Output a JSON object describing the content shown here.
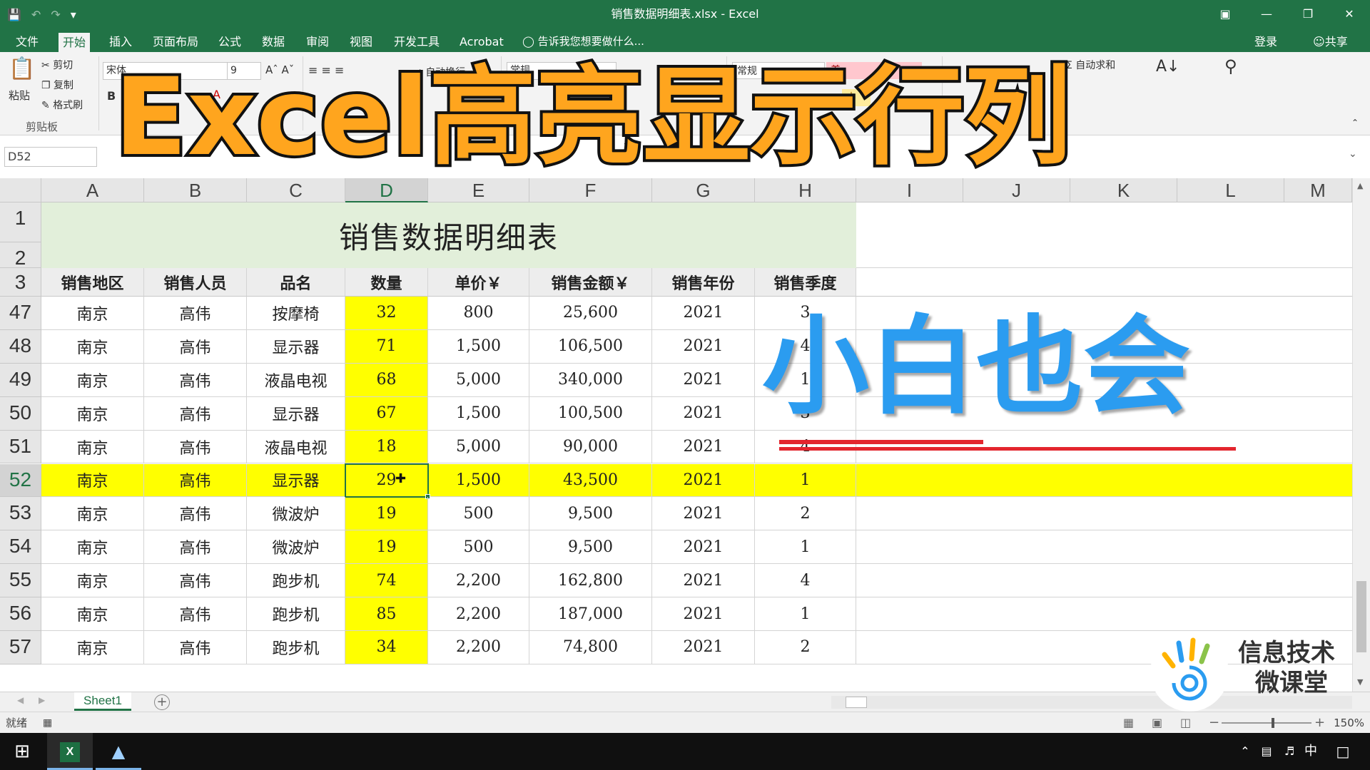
{
  "window": {
    "title": "销售数据明细表.xlsx - Excel",
    "qat_icons": [
      "save-icon",
      "undo-icon",
      "redo-icon",
      "customize-icon"
    ],
    "controls": [
      "ribbon-display-icon",
      "minimize-icon",
      "restore-icon",
      "close-icon"
    ]
  },
  "ribbon_tabs": [
    "文件",
    "开始",
    "插入",
    "页面布局",
    "公式",
    "数据",
    "审阅",
    "视图",
    "开发工具",
    "Acrobat"
  ],
  "active_tab": "开始",
  "tell_me": "告诉我您想要做什么...",
  "signin": "登录",
  "share": "共享",
  "ribbon": {
    "paste": "粘贴",
    "cut": "剪切",
    "copy": "复制",
    "format_painter": "格式刷",
    "clipboard_group": "剪贴板",
    "font_name": "宋体",
    "font_size": "9",
    "wrap_text": "自动换行",
    "number_format": "常规",
    "style_normal": "常规",
    "style_bad": "差",
    "style_neutral": "中",
    "autosum": "自动求和"
  },
  "formula_bar": {
    "name_box": "D52"
  },
  "columns": [
    "A",
    "B",
    "C",
    "D",
    "E",
    "F",
    "G",
    "H",
    "I",
    "J",
    "K",
    "L",
    "M"
  ],
  "selected_column": "D",
  "sheet_title": "销售数据明细表",
  "table_headers": [
    "销售地区",
    "销售人员",
    "品名",
    "数量",
    "单价￥",
    "销售金额￥",
    "销售年份",
    "销售季度"
  ],
  "rows": [
    {
      "num": "47",
      "cells": [
        "南京",
        "高伟",
        "按摩椅",
        "32",
        "800",
        "25,600",
        "2021",
        "3"
      ]
    },
    {
      "num": "48",
      "cells": [
        "南京",
        "高伟",
        "显示器",
        "71",
        "1,500",
        "106,500",
        "2021",
        "4"
      ]
    },
    {
      "num": "49",
      "cells": [
        "南京",
        "高伟",
        "液晶电视",
        "68",
        "5,000",
        "340,000",
        "2021",
        "1"
      ]
    },
    {
      "num": "50",
      "cells": [
        "南京",
        "高伟",
        "显示器",
        "67",
        "1,500",
        "100,500",
        "2021",
        "3"
      ]
    },
    {
      "num": "51",
      "cells": [
        "南京",
        "高伟",
        "液晶电视",
        "18",
        "5,000",
        "90,000",
        "2021",
        "4"
      ]
    },
    {
      "num": "52",
      "cells": [
        "南京",
        "高伟",
        "显示器",
        "29",
        "1,500",
        "43,500",
        "2021",
        "1"
      ]
    },
    {
      "num": "53",
      "cells": [
        "南京",
        "高伟",
        "微波炉",
        "19",
        "500",
        "9,500",
        "2021",
        "2"
      ]
    },
    {
      "num": "54",
      "cells": [
        "南京",
        "高伟",
        "微波炉",
        "19",
        "500",
        "9,500",
        "2021",
        "1"
      ]
    },
    {
      "num": "55",
      "cells": [
        "南京",
        "高伟",
        "跑步机",
        "74",
        "2,200",
        "162,800",
        "2021",
        "4"
      ]
    },
    {
      "num": "56",
      "cells": [
        "南京",
        "高伟",
        "跑步机",
        "85",
        "2,200",
        "187,000",
        "2021",
        "1"
      ]
    },
    {
      "num": "57",
      "cells": [
        "南京",
        "高伟",
        "跑步机",
        "34",
        "2,200",
        "74,800",
        "2021",
        "2"
      ]
    }
  ],
  "highlight_row": "52",
  "highlight_color": "#ffff00",
  "accent_color": "#217346",
  "sheet_tab": "Sheet1",
  "status": {
    "ready": "就绪",
    "zoom": "150%"
  },
  "overlay": {
    "title": "Excel高亮显示行列",
    "title_color": "#ffa51e",
    "subtitle": "小白也会",
    "subtitle_color": "#2b9cf0",
    "logo_line1": "信息技术",
    "logo_line2": "微课堂"
  },
  "taskbar": {
    "ime": "中",
    "icons": [
      "windows-start-icon",
      "excel-taskbar-icon",
      "app-taskbar-icon"
    ]
  }
}
